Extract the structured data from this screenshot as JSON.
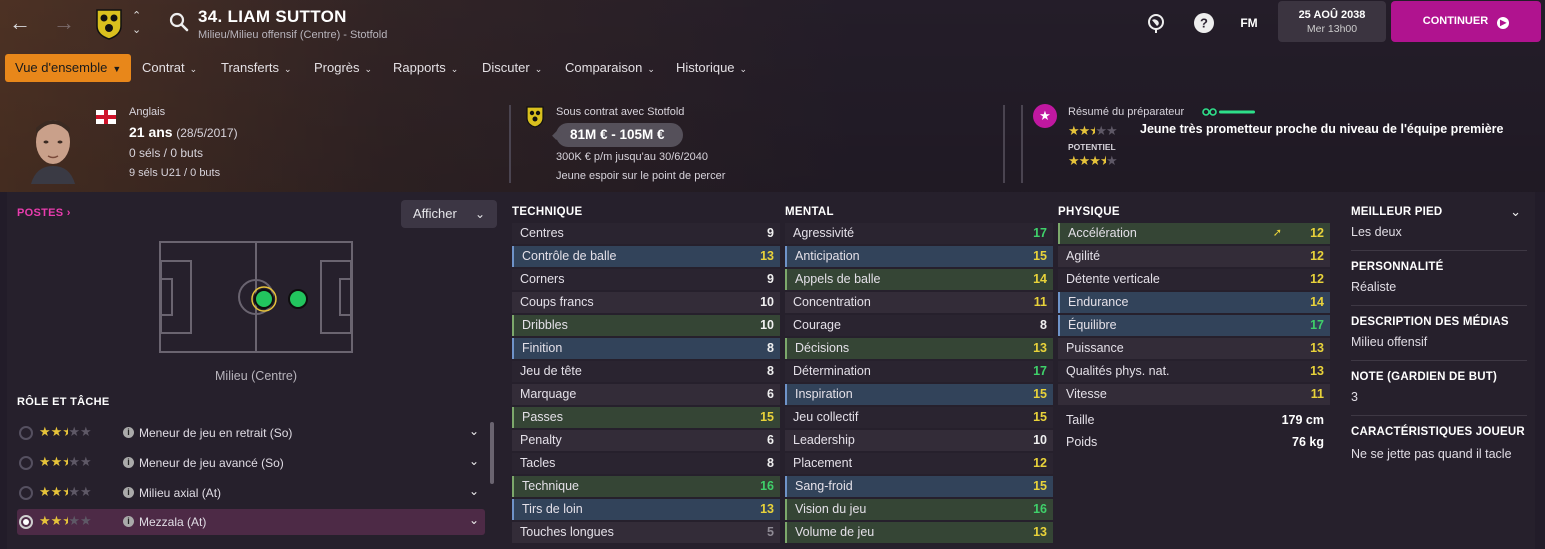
{
  "header": {
    "player_title": "34. LIAM SUTTON",
    "player_subtitle": "Milieu/Milieu offensif (Centre) - Stotfold",
    "fm_label": "FM",
    "date": "25 AOÛ 2038",
    "day_time": "Mer 13h00",
    "continue_label": "CONTINUER"
  },
  "menu": [
    {
      "label": "Vue d'ensemble",
      "active": true
    },
    {
      "label": "Contrat"
    },
    {
      "label": "Transferts"
    },
    {
      "label": "Progrès"
    },
    {
      "label": "Rapports"
    },
    {
      "label": "Discuter"
    },
    {
      "label": "Comparaison"
    },
    {
      "label": "Historique"
    }
  ],
  "profile": {
    "nationality": "Anglais",
    "age": "21 ans",
    "dob": "(28/5/2017)",
    "caps": "0 séls / 0 buts",
    "u21_caps": "9 séls U21 / 0 buts"
  },
  "contract": {
    "label": "Sous contrat avec Stotfold",
    "value_range": "81M € - 105M €",
    "wage": "300K € p/m jusqu'au 30/6/2040",
    "status": "Jeune espoir sur le point de percer"
  },
  "scout": {
    "title": "Résumé du préparateur",
    "summary": "Jeune très prometteur proche du niveau de l'équipe première",
    "current_stars": 2.5,
    "potential_label": "POTENTIEL",
    "potential_stars": 3.5,
    "colors": {
      "badge": "#c018a0",
      "bar": "#2ee08a",
      "star": "#e6c33a"
    }
  },
  "positions": {
    "title": "POSTES",
    "show_label": "Afficher",
    "pitch_label": "Milieu (Centre)"
  },
  "roles": {
    "title": "RÔLE ET TÂCHE",
    "items": [
      {
        "name": "Meneur de jeu en retrait (So)",
        "stars": 2.5,
        "selected": false
      },
      {
        "name": "Meneur de jeu avancé (So)",
        "stars": 2.5,
        "selected": false
      },
      {
        "name": "Milieu axial (At)",
        "stars": 2.5,
        "selected": false
      },
      {
        "name": "Mezzala (At)",
        "stars": 2.5,
        "selected": true
      }
    ]
  },
  "technique": {
    "title": "TECHNIQUE",
    "items": [
      {
        "name": "Centres",
        "value": "9",
        "hl": "plain"
      },
      {
        "name": "Contrôle de balle",
        "value": "13",
        "hl": "blue"
      },
      {
        "name": "Corners",
        "value": "9",
        "hl": "plain"
      },
      {
        "name": "Coups francs",
        "value": "10",
        "hl": "plain"
      },
      {
        "name": "Dribbles",
        "value": "10",
        "hl": "green"
      },
      {
        "name": "Finition",
        "value": "8",
        "hl": "blue"
      },
      {
        "name": "Jeu de tête",
        "value": "8",
        "hl": "plain"
      },
      {
        "name": "Marquage",
        "value": "6",
        "hl": "plain"
      },
      {
        "name": "Passes",
        "value": "15",
        "hl": "green"
      },
      {
        "name": "Penalty",
        "value": "6",
        "hl": "plain"
      },
      {
        "name": "Tacles",
        "value": "8",
        "hl": "plain"
      },
      {
        "name": "Technique",
        "value": "16",
        "hl": "green"
      },
      {
        "name": "Tirs de loin",
        "value": "13",
        "hl": "blue"
      },
      {
        "name": "Touches longues",
        "value": "5",
        "hl": "plain"
      }
    ]
  },
  "mental": {
    "title": "MENTAL",
    "items": [
      {
        "name": "Agressivité",
        "value": "17",
        "hl": "plain"
      },
      {
        "name": "Anticipation",
        "value": "15",
        "hl": "blue"
      },
      {
        "name": "Appels de balle",
        "value": "14",
        "hl": "green"
      },
      {
        "name": "Concentration",
        "value": "11",
        "hl": "plain"
      },
      {
        "name": "Courage",
        "value": "8",
        "hl": "plain"
      },
      {
        "name": "Décisions",
        "value": "13",
        "hl": "green"
      },
      {
        "name": "Détermination",
        "value": "17",
        "hl": "plain"
      },
      {
        "name": "Inspiration",
        "value": "15",
        "hl": "blue"
      },
      {
        "name": "Jeu collectif",
        "value": "15",
        "hl": "plain"
      },
      {
        "name": "Leadership",
        "value": "10",
        "hl": "plain"
      },
      {
        "name": "Placement",
        "value": "12",
        "hl": "plain"
      },
      {
        "name": "Sang-froid",
        "value": "15",
        "hl": "blue"
      },
      {
        "name": "Vision du jeu",
        "value": "16",
        "hl": "green"
      },
      {
        "name": "Volume de jeu",
        "value": "13",
        "hl": "green"
      }
    ]
  },
  "physique": {
    "title": "PHYSIQUE",
    "items": [
      {
        "name": "Accélération",
        "value": "12",
        "hl": "green",
        "trend": "up"
      },
      {
        "name": "Agilité",
        "value": "12",
        "hl": "plain"
      },
      {
        "name": "Détente verticale",
        "value": "12",
        "hl": "plain"
      },
      {
        "name": "Endurance",
        "value": "14",
        "hl": "blue"
      },
      {
        "name": "Équilibre",
        "value": "17",
        "hl": "blue"
      },
      {
        "name": "Puissance",
        "value": "13",
        "hl": "plain"
      },
      {
        "name": "Qualités phys. nat.",
        "value": "13",
        "hl": "plain"
      },
      {
        "name": "Vitesse",
        "value": "11",
        "hl": "plain"
      }
    ],
    "height_label": "Taille",
    "height": "179 cm",
    "weight_label": "Poids",
    "weight": "76 kg"
  },
  "details": [
    {
      "title": "MEILLEUR PIED",
      "value": "Les deux"
    },
    {
      "title": "PERSONNALITÉ",
      "value": "Réaliste"
    },
    {
      "title": "DESCRIPTION DES MÉDIAS",
      "value": "Milieu offensif"
    },
    {
      "title": "NOTE (GARDIEN DE BUT)",
      "value": "3"
    },
    {
      "title": "CARACTÉRISTIQUES JOUEUR",
      "value": "Ne se jette pas quand il tacle"
    }
  ]
}
